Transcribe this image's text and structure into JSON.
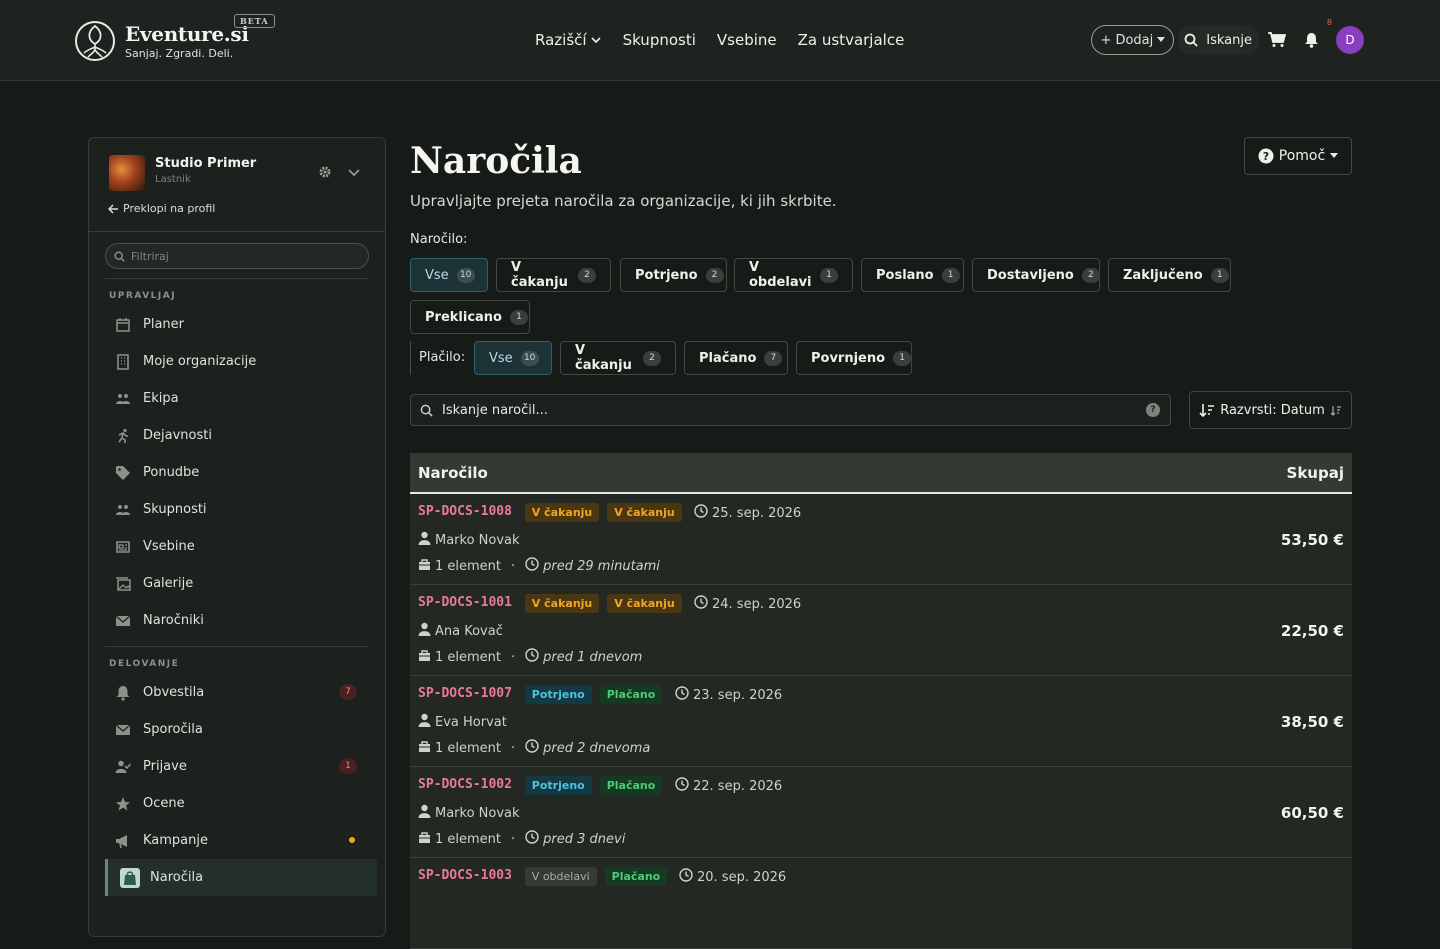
{
  "brand": {
    "name": "Eventure.si",
    "beta": "BETA",
    "tagline": "Sanjaj. Zgradi. Deli."
  },
  "nav": {
    "items": [
      {
        "label": "Raziščí",
        "dropdown": true
      },
      {
        "label": "Skupnosti"
      },
      {
        "label": "Vsebine"
      },
      {
        "label": "Za ustvarjalce"
      }
    ],
    "add_label": "+ Dodaj",
    "search_label": "Iskanje",
    "notif_count": "8",
    "avatar_letter": "D"
  },
  "org": {
    "name": "Studio Primer",
    "role": "Lastnik",
    "switch_label": "Preklopi na profil"
  },
  "sidebar": {
    "filter_placeholder": "Filtriraj",
    "manage_title": "UPRAVLJAJ",
    "manage_items": [
      {
        "label": "Planer",
        "icon": "calendar-icon"
      },
      {
        "label": "Moje organizacije",
        "icon": "building-icon"
      },
      {
        "label": "Ekipa",
        "icon": "team-icon"
      },
      {
        "label": "Dejavnosti",
        "icon": "running-icon"
      },
      {
        "label": "Ponudbe",
        "icon": "tag-icon"
      },
      {
        "label": "Skupnosti",
        "icon": "people-icon"
      },
      {
        "label": "Vsebine",
        "icon": "newspaper-icon"
      },
      {
        "label": "Galerije",
        "icon": "images-icon"
      },
      {
        "label": "Naročniki",
        "icon": "envelope-icon"
      }
    ],
    "ops_title": "DELOVANJE",
    "ops_items": [
      {
        "label": "Obvestila",
        "icon": "bell-icon",
        "badge": "7"
      },
      {
        "label": "Sporočila",
        "icon": "envelope-icon"
      },
      {
        "label": "Prijave",
        "icon": "user-check-icon",
        "badge": "1"
      },
      {
        "label": "Ocene",
        "icon": "star-icon"
      },
      {
        "label": "Kampanje",
        "icon": "megaphone-icon",
        "dot": true
      },
      {
        "label": "Naročila",
        "icon": "shopping-bag-icon",
        "active": true
      }
    ]
  },
  "page": {
    "title": "Naročila",
    "subtitle": "Upravljajte prejeta naročila za organizacije, ki jih skrbite.",
    "help_label": "Pomoč"
  },
  "filters": {
    "order_label": "Naročilo:",
    "order_chips": [
      {
        "label": "Vse",
        "count": "10",
        "selected": true
      },
      {
        "label": "V čakanju",
        "count": "2"
      },
      {
        "label": "Potrjeno",
        "count": "2"
      },
      {
        "label": "V obdelavi",
        "count": "1"
      },
      {
        "label": "Poslano",
        "count": "1"
      },
      {
        "label": "Dostavljeno",
        "count": "2"
      },
      {
        "label": "Zaključeno",
        "count": "1"
      },
      {
        "label": "Preklicano",
        "count": "1"
      }
    ],
    "payment_label": "Plačilo:",
    "payment_chips": [
      {
        "label": "Vse",
        "count": "10",
        "selected": true
      },
      {
        "label": "V čakanju",
        "count": "2"
      },
      {
        "label": "Plačano",
        "count": "7"
      },
      {
        "label": "Povrnjeno",
        "count": "1"
      }
    ]
  },
  "search": {
    "placeholder": "Iskanje naročil...",
    "help": "?"
  },
  "sort": {
    "label": "Razvrsti: Datum"
  },
  "table": {
    "col_order": "Naročilo",
    "col_total": "Skupaj",
    "rows": [
      {
        "id": "SP-DOCS-1008",
        "status": "V čakanju",
        "status_kind": "wait",
        "payment": "V čakanju",
        "payment_kind": "wait",
        "date": "25. sep. 2026",
        "customer": "Marko Novak",
        "items": "1 element",
        "ago": "pred 29 minutami",
        "total": "53,50 €"
      },
      {
        "id": "SP-DOCS-1001",
        "status": "V čakanju",
        "status_kind": "wait",
        "payment": "V čakanju",
        "payment_kind": "wait",
        "date": "24. sep. 2026",
        "customer": "Ana Kovač",
        "items": "1 element",
        "ago": "pred 1 dnevom",
        "total": "22,50 €"
      },
      {
        "id": "SP-DOCS-1007",
        "status": "Potrjeno",
        "status_kind": "conf",
        "payment": "Plačano",
        "payment_kind": "paid",
        "date": "23. sep. 2026",
        "customer": "Eva Horvat",
        "items": "1 element",
        "ago": "pred 2 dnevoma",
        "total": "38,50 €"
      },
      {
        "id": "SP-DOCS-1002",
        "status": "Potrjeno",
        "status_kind": "conf",
        "payment": "Plačano",
        "payment_kind": "paid",
        "date": "22. sep. 2026",
        "customer": "Marko Novak",
        "items": "1 element",
        "ago": "pred 3 dnevi",
        "total": "60,50 €"
      },
      {
        "id": "SP-DOCS-1003",
        "status": "V obdelavi",
        "status_kind": "proc",
        "payment": "Plačano",
        "payment_kind": "paid",
        "date": "20. sep. 2026",
        "customer": "",
        "items": "",
        "ago": "",
        "total": ""
      }
    ]
  },
  "colors": {
    "accent": "#2f6068",
    "order_id": "#e97a9c",
    "wait": "#f0a623",
    "confirmed": "#4fc3db",
    "paid": "#4fca79"
  }
}
